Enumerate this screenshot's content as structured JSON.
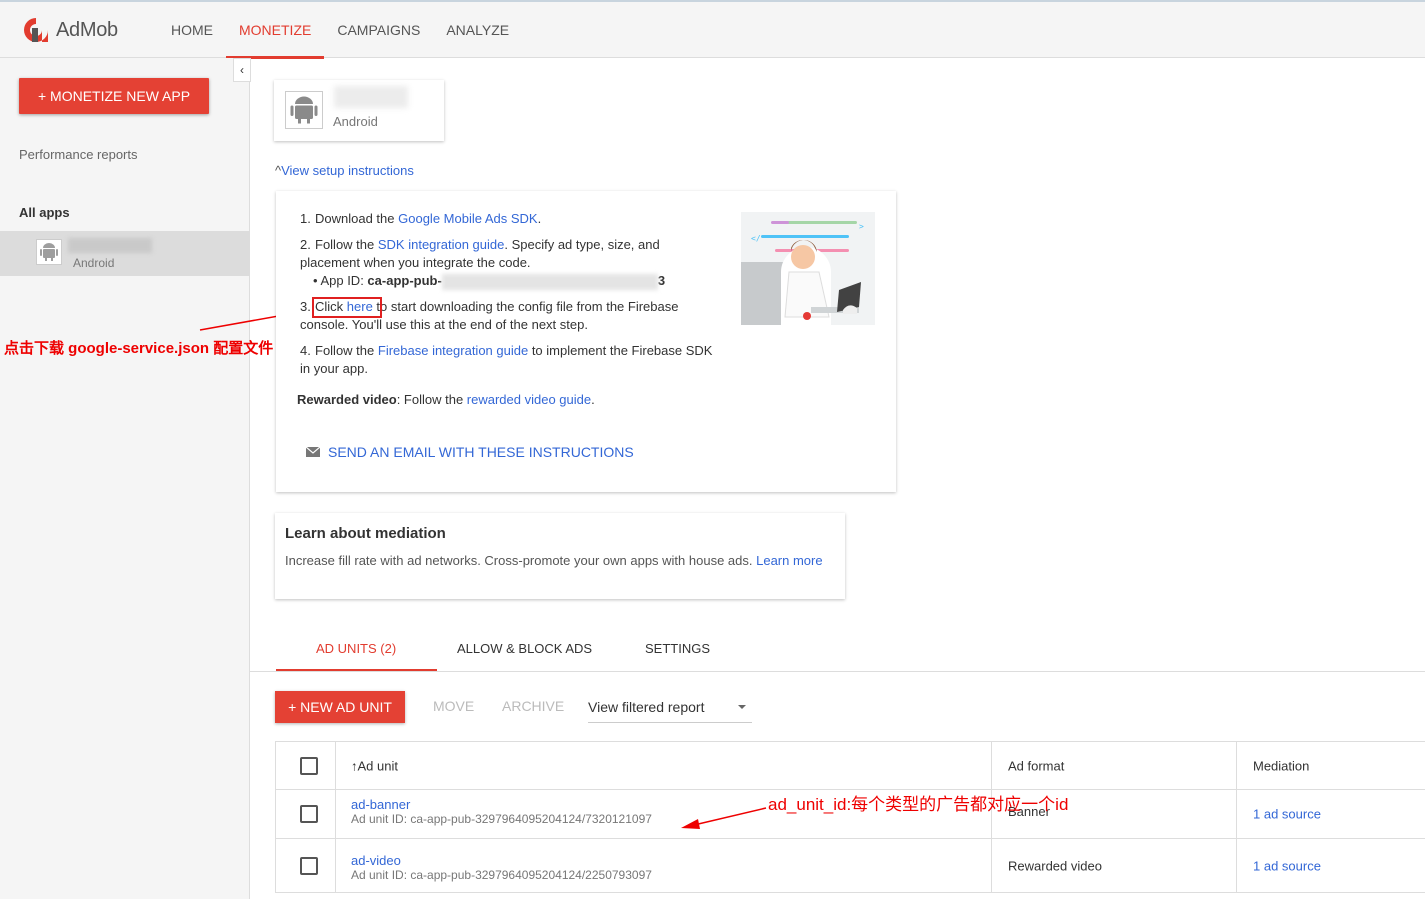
{
  "app": {
    "name": "AdMob"
  },
  "nav": {
    "items": [
      "HOME",
      "MONETIZE",
      "CAMPAIGNS",
      "ANALYZE"
    ],
    "active": "MONETIZE"
  },
  "sidebar": {
    "collapse": "‹",
    "monetize_button": "MONETIZE NEW APP",
    "performance_reports": "Performance reports",
    "all_apps": "All apps",
    "app_platform": "Android"
  },
  "app_card": {
    "platform": "Android"
  },
  "setup": {
    "view_instructions": "View setup instructions",
    "step1_num": "1.",
    "step1_pre": "Download the ",
    "step1_link": "Google Mobile Ads SDK",
    "step1_post": ".",
    "step2_num": "2.",
    "step2_pre": "Follow the ",
    "step2_link": "SDK integration guide",
    "step2_post": ". Specify ad type, size, and placement when you integrate the code.",
    "app_id_label": "App ID: ",
    "app_id_prefix": "ca-app-pub-",
    "app_id_suffix": "3",
    "step3_num": "3.",
    "step3_pre": "Click ",
    "step3_link": "here",
    "step3_post": " to start downloading the config file from the Firebase console. You'll use this at the end of the next step.",
    "step4_num": "4.",
    "step4_pre": "Follow the ",
    "step4_link": "Firebase integration guide",
    "step4_post": " to implement the Firebase SDK in your app.",
    "rewarded_label": "Rewarded video",
    "rewarded_pre": ": Follow the ",
    "rewarded_link": "rewarded video guide",
    "rewarded_post": ".",
    "email_button": "SEND AN EMAIL WITH THESE INSTRUCTIONS"
  },
  "mediation": {
    "title": "Learn about mediation",
    "body": "Increase fill rate with ad networks. Cross-promote your own apps with house ads. ",
    "link": "Learn more"
  },
  "tabs": [
    "AD UNITS (2)",
    "ALLOW & BLOCK ADS",
    "SETTINGS"
  ],
  "toolbar": {
    "new_ad_unit": "NEW AD UNIT",
    "move": "MOVE",
    "archive": "ARCHIVE",
    "filter_value": "View filtered report"
  },
  "table": {
    "headers": {
      "ad_unit": "Ad unit",
      "ad_format": "Ad format",
      "mediation": "Mediation"
    },
    "sort_icon": "↑",
    "rows": [
      {
        "name": "ad-banner",
        "id": "Ad unit ID: ca-app-pub-3297964095204124/7320121097",
        "format": "Banner",
        "mediation": "1 ad source"
      },
      {
        "name": "ad-video",
        "id": "Ad unit ID: ca-app-pub-3297964095204124/2250793097",
        "format": "Rewarded video",
        "mediation": "1 ad source"
      }
    ]
  },
  "annotations": {
    "left": "点击下载 google-service.json 配置文件",
    "right": "ad_unit_id:每个类型的广告都对应一个id"
  },
  "colors": {
    "accent": "#e23c2f",
    "button": "#e44134",
    "link": "#3367d6",
    "annotation": "#ee0000"
  }
}
